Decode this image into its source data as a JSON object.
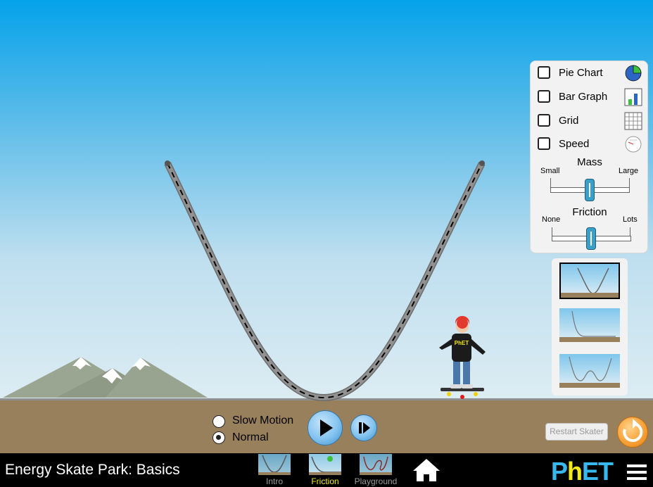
{
  "controls": {
    "pie_chart_label": "Pie Chart",
    "bar_graph_label": "Bar Graph",
    "grid_label": "Grid",
    "speed_label": "Speed",
    "mass_title": "Mass",
    "mass_min_label": "Small",
    "mass_max_label": "Large",
    "mass_value": 0.5,
    "friction_title": "Friction",
    "friction_min_label": "None",
    "friction_max_label": "Lots",
    "friction_value": 0.5
  },
  "playback": {
    "slow_motion_label": "Slow Motion",
    "normal_label": "Normal",
    "selected_speed": "normal"
  },
  "restart_skater_label": "Restart Skater",
  "skater": {
    "shirt_logo": "PhET"
  },
  "navbar": {
    "title": "Energy Skate Park: Basics",
    "screens": [
      {
        "label": "Intro"
      },
      {
        "label": "Friction"
      },
      {
        "label": "Playground"
      }
    ],
    "active_screen": "Friction"
  },
  "colors": {
    "sky_top": "#04a2ea",
    "ground": "#99805d",
    "accent_orange": "#f7a23b",
    "nav_active": "#f2e916"
  },
  "icons": {
    "pie": "pie-chart-icon",
    "bar": "bar-graph-icon",
    "grid": "grid-icon",
    "speed": "speedometer-icon",
    "play": "play-icon",
    "step": "step-forward-icon",
    "reset": "reset-all-icon",
    "home": "home-icon",
    "menu": "hamburger-menu-icon"
  }
}
